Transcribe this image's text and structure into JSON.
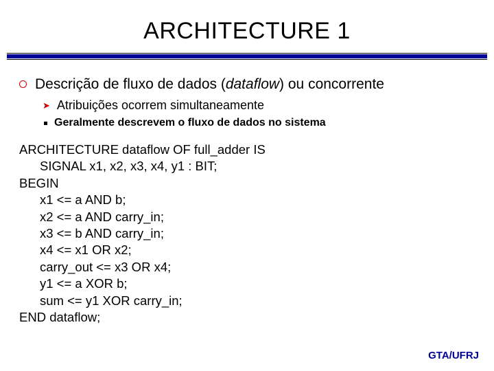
{
  "title": "ARCHITECTURE 1",
  "bullets": {
    "l1_pre": "Descrição de fluxo de dados (",
    "l1_ital": "dataflow",
    "l1_post": ") ou concorrente",
    "l2": "Atribuições ocorrem simultaneamente",
    "l3": "Geralmente descrevem o fluxo de dados no sistema"
  },
  "code": {
    "line1": "ARCHITECTURE dataflow OF full_adder IS",
    "line2": "SIGNAL x1, x2, x3, x4, y1 : BIT;",
    "line3": "BEGIN",
    "line4": "x1 <= a AND b;",
    "line5": "x2 <= a AND carry_in;",
    "line6": "x3 <= b AND carry_in;",
    "line7": "x4 <= x1 OR x2;",
    "line8": "carry_out <= x3 OR x4;",
    "line9": "y1 <= a XOR b;",
    "line10": "sum <= y1 XOR carry_in;",
    "line11": "END dataflow;"
  },
  "footer": "GTA/UFRJ"
}
